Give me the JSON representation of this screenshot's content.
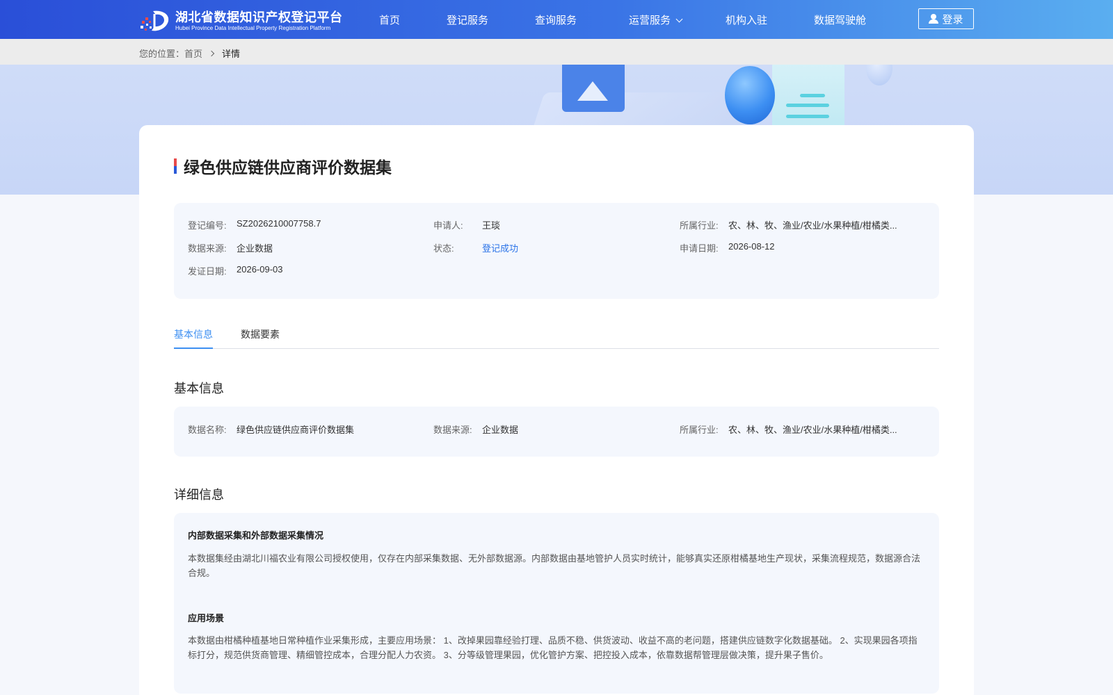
{
  "header": {
    "logo_cn": "湖北省数据知识产权登记平台",
    "logo_en": "Hubei Province Data Intellectual Property Registration Platform",
    "nav": [
      {
        "label": "首页"
      },
      {
        "label": "登记服务"
      },
      {
        "label": "查询服务"
      },
      {
        "label": "运营服务"
      },
      {
        "label": "机构入驻"
      },
      {
        "label": "数据驾驶舱"
      }
    ],
    "login_label": "登录"
  },
  "breadcrumb": {
    "prefix": "您的位置：",
    "home": "首页",
    "current": "详情"
  },
  "detail": {
    "title": "绿色供应链供应商评价数据集",
    "meta": {
      "reg_no_label": "登记编号:",
      "reg_no": "SZ2026210007758.7",
      "applicant_label": "申请人:",
      "applicant": "王琰",
      "industry_label": "所属行业:",
      "industry": "农、林、牧、渔业/农业/水果种植/柑橘类...",
      "source_label": "数据来源:",
      "source": "企业数据",
      "status_label": "状态:",
      "status": "登记成功",
      "apply_date_label": "申请日期:",
      "apply_date": "2026-08-12",
      "issue_date_label": "发证日期:",
      "issue_date": "2026-09-03"
    },
    "tabs": [
      {
        "label": "基本信息"
      },
      {
        "label": "数据要素"
      }
    ],
    "basic": {
      "section_title": "基本信息",
      "name_label": "数据名称:",
      "name": "绿色供应链供应商评价数据集",
      "source_label": "数据来源:",
      "source": "企业数据",
      "industry_label": "所属行业:",
      "industry": "农、林、牧、渔业/农业/水果种植/柑橘类..."
    },
    "detailed": {
      "section_title": "详细信息",
      "collection_title": "内部数据采集和外部数据采集情况",
      "collection_text": "本数据集经由湖北川福农业有限公司授权使用，仅存在内部采集数据、无外部数据源。内部数据由基地管护人员实时统计，能够真实还原柑橘基地生产现状，采集流程规范，数据源合法合规。",
      "scenario_title": "应用场景",
      "scenario_text": "本数据由柑橘种植基地日常种植作业采集形成，主要应用场景：  1、改掉果园靠经验打理、品质不稳、供货波动、收益不高的老问题，搭建供应链数字化数据基础。  2、实现果园各项指标打分，规范供货商管理、精细管控成本，合理分配人力农资。  3、分等级管理果园，优化管护方案、把控投入成本，依靠数据帮管理层做决策，提升果子售价。"
    }
  }
}
